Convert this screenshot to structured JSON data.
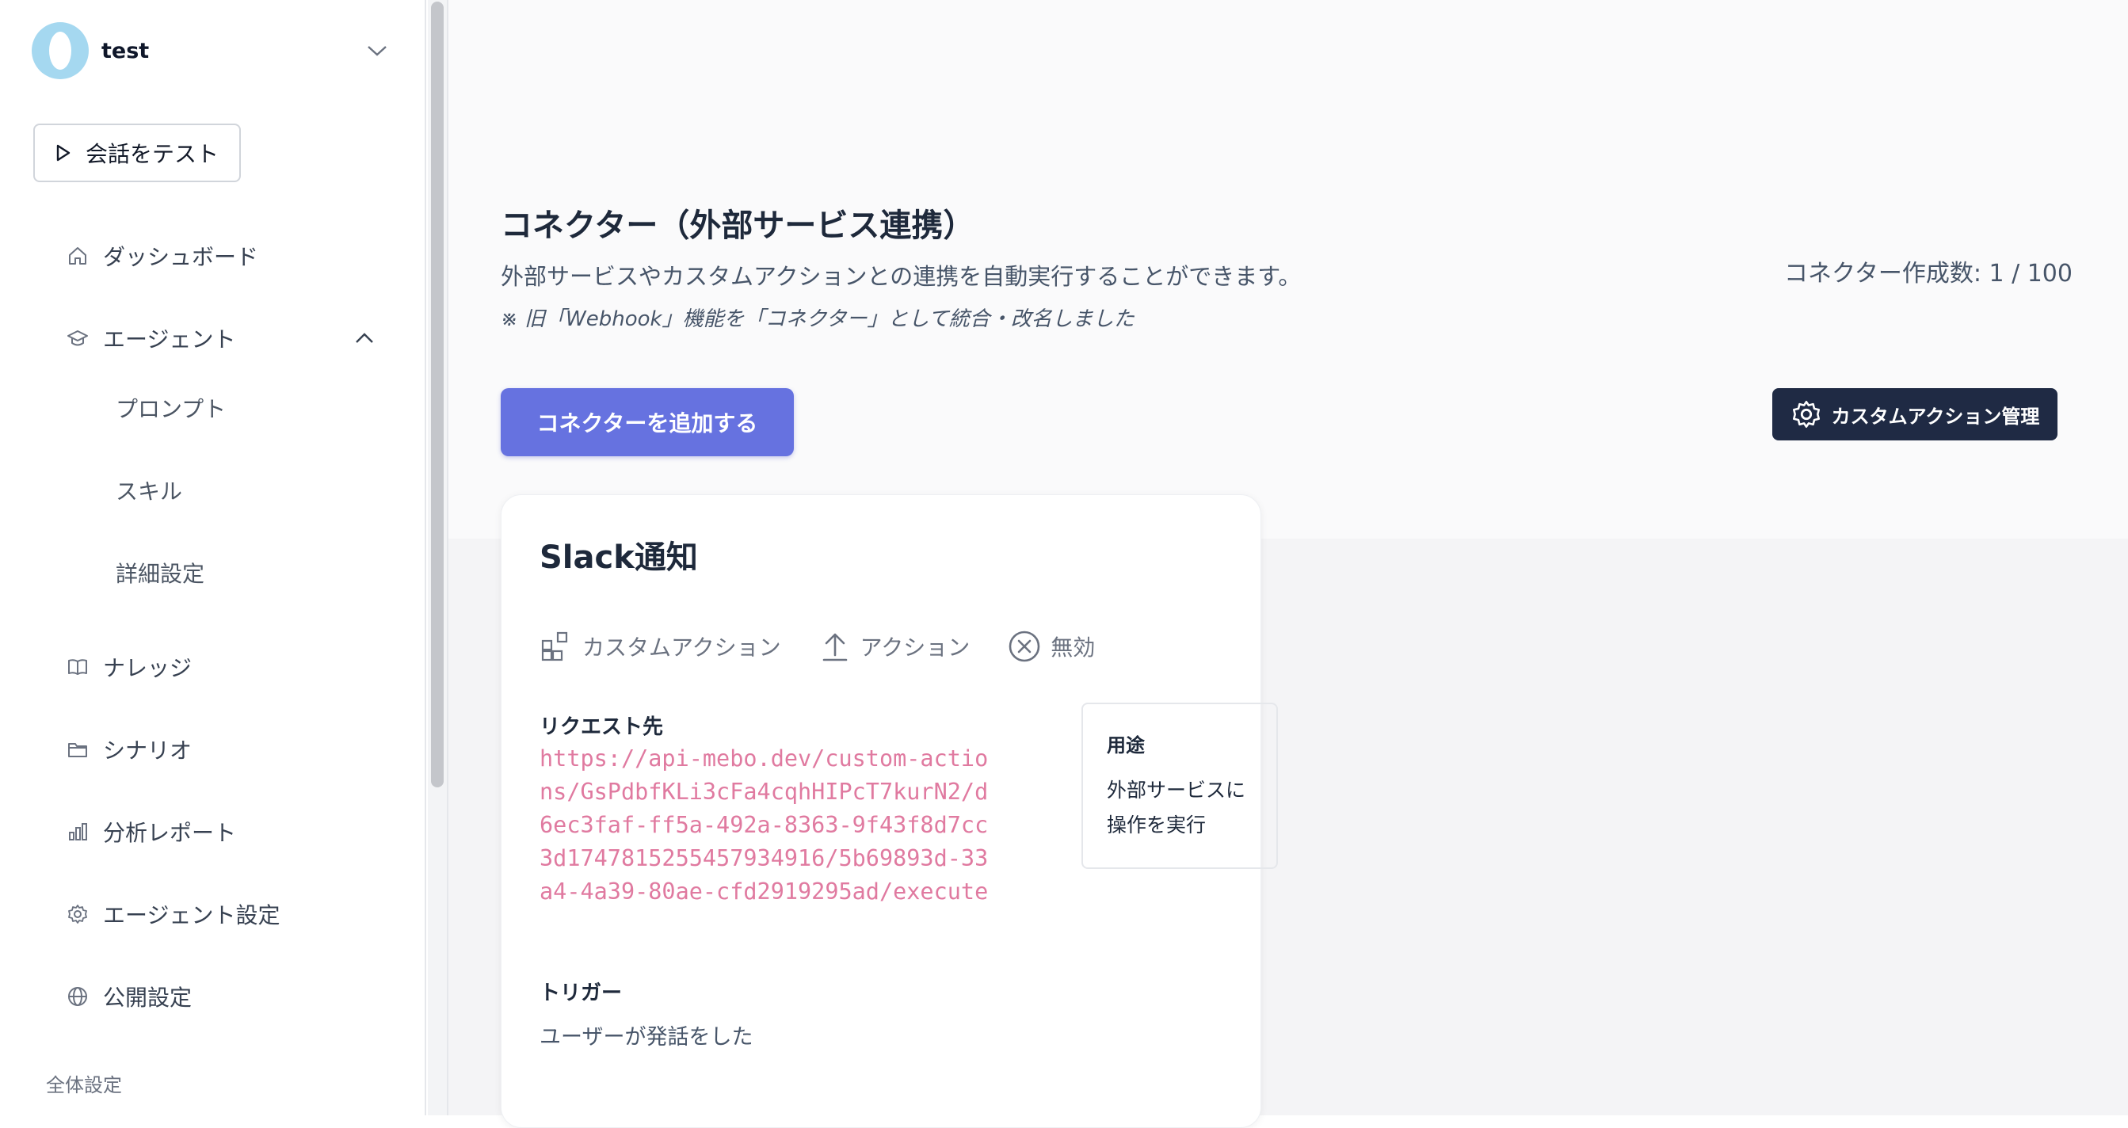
{
  "sidebar": {
    "org_name": "test",
    "test_button": "会話をテスト",
    "items": [
      {
        "label": "ダッシュボード",
        "icon": "home-icon"
      },
      {
        "label": "エージェント",
        "icon": "agent-icon",
        "expanded": true
      },
      {
        "label": "ナレッジ",
        "icon": "book-icon"
      },
      {
        "label": "シナリオ",
        "icon": "folder-icon"
      },
      {
        "label": "分析レポート",
        "icon": "bar-chart-icon"
      },
      {
        "label": "エージェント設定",
        "icon": "gear-icon"
      },
      {
        "label": "公開設定",
        "icon": "globe-icon"
      }
    ],
    "agent_subitems": [
      "プロンプト",
      "スキル",
      "詳細設定"
    ],
    "section_label": "全体設定"
  },
  "main": {
    "title": "コネクター（外部サービス連携）",
    "description": "外部サービスやカスタムアクションとの連携を自動実行することができます。",
    "note": "※ 旧「Webhook」機能を「コネクター」として統合・改名しました",
    "count": "コネクター作成数: 1 / 100",
    "add_button": "コネクターを追加する",
    "manage_button": "カスタムアクション管理",
    "accent_color": "#6672e0",
    "dark_button_color": "#1f2a44"
  },
  "card": {
    "title": "Slack通知",
    "badges": [
      {
        "label": "カスタムアクション",
        "icon": "custom-action-icon"
      },
      {
        "label": "アクション",
        "icon": "upload-icon"
      },
      {
        "label": "無効",
        "icon": "x-circle-icon"
      }
    ],
    "request_label": "リクエスト先",
    "request_url": "https://api-mebo.dev/custom-actions/GsPdbfKLi3cFa4cqhHIPcT7kurN2/d6ec3faf-ff5a-492a-8363-9f43f8d7cc3d1747815255457934916/5b69893d-33a4-4a39-80ae-cfd2919295ad/execute",
    "trigger_label": "トリガー",
    "trigger_value": "ユーザーが発話をした",
    "purpose_title": "用途",
    "purpose_text": "外部サービスに操作を実行"
  }
}
